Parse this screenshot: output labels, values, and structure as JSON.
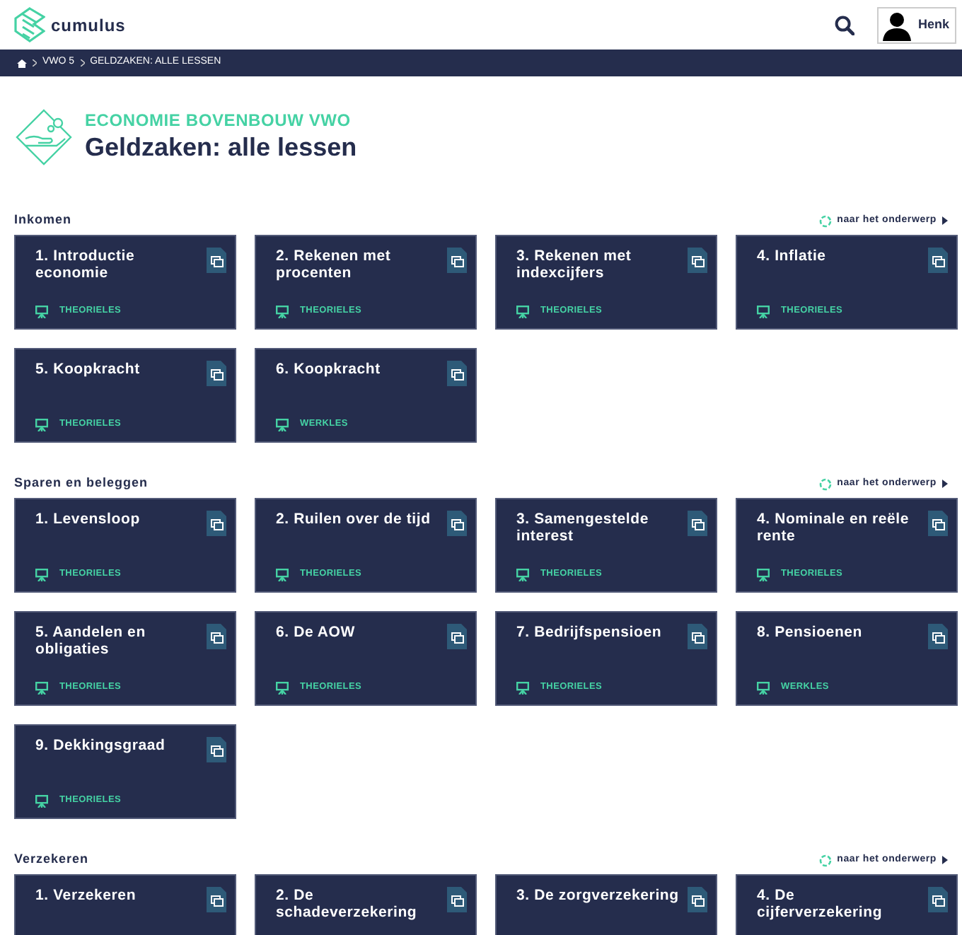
{
  "header": {
    "logo_text": "cumulus",
    "user_name": "Henk"
  },
  "breadcrumb": [
    "VWO 5",
    "GELDZAKEN: ALLE LESSEN"
  ],
  "page": {
    "subject": "ECONOMIE BOVENBOUW VWO",
    "title": "Geldzaken: alle lessen"
  },
  "sections": [
    {
      "title": "Inkomen",
      "link": "naar het onderwerp",
      "lessons": [
        {
          "title": "1. Introductie economie",
          "type": "THEORIELES"
        },
        {
          "title": "2. Rekenen met procenten",
          "type": "THEORIELES"
        },
        {
          "title": "3. Rekenen met indexcijfers",
          "type": "THEORIELES"
        },
        {
          "title": "4. Inflatie",
          "type": "THEORIELES"
        },
        {
          "title": "5. Koopkracht",
          "type": "THEORIELES"
        },
        {
          "title": "6. Koopkracht",
          "type": "WERKLES"
        }
      ]
    },
    {
      "title": "Sparen en beleggen",
      "link": "naar het onderwerp",
      "lessons": [
        {
          "title": "1. Levensloop",
          "type": "THEORIELES"
        },
        {
          "title": "2. Ruilen over de tijd",
          "type": "THEORIELES"
        },
        {
          "title": "3. Samengestelde interest",
          "type": "THEORIELES"
        },
        {
          "title": "4. Nominale en reële rente",
          "type": "THEORIELES"
        },
        {
          "title": "5. Aandelen en obligaties",
          "type": "THEORIELES"
        },
        {
          "title": "6. De AOW",
          "type": "THEORIELES"
        },
        {
          "title": "7. Bedrijfspensioen",
          "type": "THEORIELES"
        },
        {
          "title": "8. Pensioenen",
          "type": "WERKLES"
        },
        {
          "title": "9. Dekkingsgraad",
          "type": "THEORIELES"
        }
      ]
    },
    {
      "title": "Verzekeren",
      "link": "naar het onderwerp",
      "lessons": [
        {
          "title": "1. Verzekeren"
        },
        {
          "title": "2. De schadeverzekering"
        },
        {
          "title": "3. De zorgverzekering"
        },
        {
          "title": "4. De cijferverzekering"
        }
      ]
    }
  ]
}
